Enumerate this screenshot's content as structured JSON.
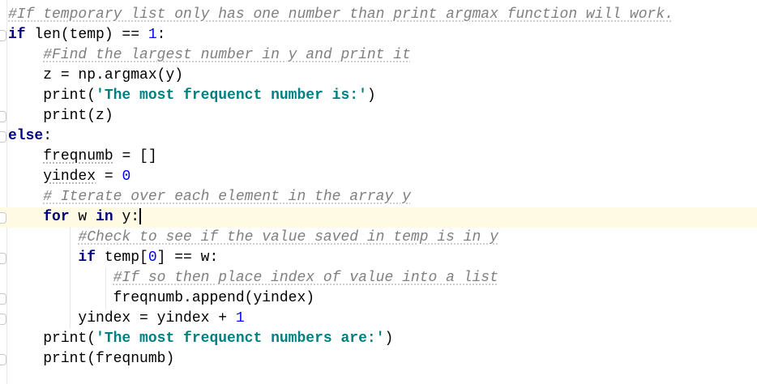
{
  "editor": {
    "language": "python",
    "current_line": 10,
    "colors": {
      "keyword": "#000080",
      "comment": "#808080",
      "number": "#0000ff",
      "string": "#008080",
      "current_line_bg": "#fffae3"
    },
    "lines": [
      {
        "indent": 0,
        "tokens": [
          {
            "t": "cm",
            "s": "#If temporary list only has one number than print argmax function will work."
          }
        ]
      },
      {
        "indent": 0,
        "tokens": [
          {
            "t": "kw",
            "s": "if"
          },
          {
            "t": "",
            "s": " len(temp) == "
          },
          {
            "t": "num",
            "s": "1"
          },
          {
            "t": "",
            "s": ":"
          }
        ]
      },
      {
        "indent": 4,
        "tokens": [
          {
            "t": "cm",
            "s": "#Find the largest number in y and print it"
          }
        ]
      },
      {
        "indent": 4,
        "tokens": [
          {
            "t": "",
            "s": "z = np.argmax(y)"
          }
        ]
      },
      {
        "indent": 4,
        "tokens": [
          {
            "t": "",
            "s": "print("
          },
          {
            "t": "str",
            "s": "'The most frequenct number is:'"
          },
          {
            "t": "",
            "s": ")"
          }
        ]
      },
      {
        "indent": 4,
        "tokens": [
          {
            "t": "",
            "s": "print(z)"
          }
        ]
      },
      {
        "indent": 0,
        "tokens": [
          {
            "t": "kw",
            "s": "else"
          },
          {
            "t": "",
            "s": ":"
          }
        ]
      },
      {
        "indent": 4,
        "tokens": [
          {
            "t": "typo",
            "s": "freqnumb"
          },
          {
            "t": "",
            "s": " = []"
          }
        ]
      },
      {
        "indent": 4,
        "tokens": [
          {
            "t": "typo",
            "s": "yindex"
          },
          {
            "t": "",
            "s": " = "
          },
          {
            "t": "num",
            "s": "0"
          }
        ]
      },
      {
        "indent": 4,
        "tokens": [
          {
            "t": "cm",
            "s": "# Iterate over each element in the array y"
          }
        ]
      },
      {
        "indent": 4,
        "tokens": [
          {
            "t": "kw",
            "s": "for"
          },
          {
            "t": "",
            "s": " w "
          },
          {
            "t": "kw",
            "s": "in"
          },
          {
            "t": "",
            "s": " y:"
          }
        ]
      },
      {
        "indent": 8,
        "tokens": [
          {
            "t": "cm",
            "s": "#Check to see if the value saved in temp is in y"
          }
        ]
      },
      {
        "indent": 8,
        "tokens": [
          {
            "t": "kw",
            "s": "if"
          },
          {
            "t": "",
            "s": " temp["
          },
          {
            "t": "num",
            "s": "0"
          },
          {
            "t": "",
            "s": "] == w:"
          }
        ]
      },
      {
        "indent": 12,
        "tokens": [
          {
            "t": "cm",
            "s": "#If so then place index of value into a list"
          }
        ]
      },
      {
        "indent": 12,
        "tokens": [
          {
            "t": "",
            "s": "freqnumb.append(yindex)"
          }
        ]
      },
      {
        "indent": 8,
        "tokens": [
          {
            "t": "",
            "s": "yindex = yindex + "
          },
          {
            "t": "num",
            "s": "1"
          }
        ]
      },
      {
        "indent": 4,
        "tokens": [
          {
            "t": "",
            "s": "print("
          },
          {
            "t": "str",
            "s": "'The most frequenct numbers are:'"
          },
          {
            "t": "",
            "s": ")"
          }
        ]
      },
      {
        "indent": 4,
        "tokens": [
          {
            "t": "",
            "s": "print(freqnumb)"
          }
        ]
      }
    ]
  }
}
